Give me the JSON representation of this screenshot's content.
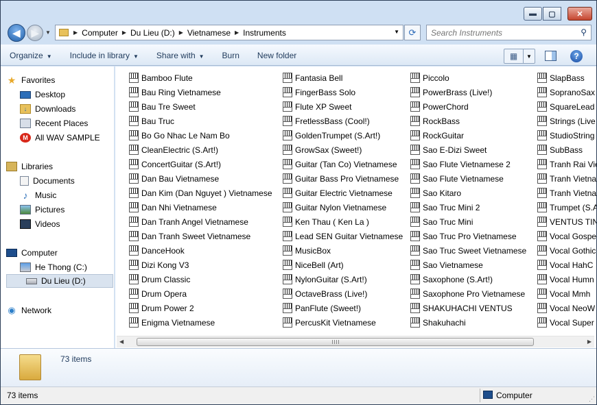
{
  "window": {
    "min_label": "▬",
    "max_label": "▢",
    "close_label": "✕"
  },
  "nav": {
    "back_icon": "arrow-left",
    "forward_icon": "arrow-right",
    "breadcrumbs": [
      "Computer",
      "Du Lieu (D:)",
      "Vietnamese",
      "Instruments"
    ],
    "search_placeholder": "Search Instruments"
  },
  "toolbar": {
    "organize": "Organize",
    "include": "Include in library",
    "share": "Share with",
    "burn": "Burn",
    "new_folder": "New folder"
  },
  "sidebar": {
    "favorites": {
      "label": "Favorites",
      "items": [
        "Desktop",
        "Downloads",
        "Recent Places",
        "All WAV SAMPLE"
      ]
    },
    "libraries": {
      "label": "Libraries",
      "items": [
        "Documents",
        "Music",
        "Pictures",
        "Videos"
      ]
    },
    "computer": {
      "label": "Computer",
      "items": [
        "He Thong (C:)",
        "Du Lieu (D:)"
      ]
    },
    "network": {
      "label": "Network"
    }
  },
  "files": {
    "col1": [
      "Bamboo Flute",
      "Bau Ring Vietnamese",
      "Bau Tre Sweet",
      "Bau Truc",
      "Bo Go Nhac Le Nam Bo",
      "CleanElectric (S.Art!)",
      "ConcertGuitar (S.Art!)",
      "Dan Bau Vietnamese",
      "Dan Kim (Dan Nguyet ) Vietnamese",
      "Dan Nhi Vietnamese",
      "Dan Tranh Angel Vietnamese",
      "Dan Tranh Sweet Vietnamese",
      "DanceHook",
      "Dizi Kong V3",
      "Drum Classic",
      "Drum Opera",
      "Drum Power 2",
      "Enigma Vietnamese"
    ],
    "col2": [
      "Fantasia Bell",
      "FingerBass Solo",
      "Flute XP Sweet",
      "FretlessBass (Cool!)",
      "GoldenTrumpet (S.Art!)",
      "GrowSax (Sweet!)",
      "Guitar (Tan Co) Vietnamese",
      "Guitar Bass Pro Vietnamese",
      "Guitar Electric Vietnamese",
      "Guitar Nylon Vietnamese",
      "Ken Thau ( Ken La )",
      "Lead SEN Guitar Vietnamese",
      "MusicBox",
      "NiceBell (Art)",
      "NylonGuitar (S.Art!)",
      "OctaveBrass (Live!)",
      "PanFlute (Sweet!)",
      "PercusKit Vietnamese"
    ],
    "col3": [
      "Piccolo",
      "PowerBrass (Live!)",
      "PowerChord",
      "RockBass",
      "RockGuitar",
      "Sao E-Dizi Sweet",
      "Sao Flute Vietnamese 2",
      "Sao Flute Vietnamese",
      "Sao Kitaro",
      "Sao Truc Mini 2",
      "Sao Truc Mini",
      "Sao Truc Pro Vietnamese",
      "Sao Truc Sweet Vietnamese",
      "Sao Vietnamese",
      "Saxophone (S.Art!)",
      "Saxophone Pro Vietnamese",
      "SHAKUHACHI VENTUS",
      "Shakuhachi"
    ],
    "col4": [
      "SlapBass",
      "SopranoSax",
      "SquareLead",
      "Strings (Live",
      "StudioString",
      "SubBass",
      "Tranh Rai Vie",
      "Tranh Vietna",
      "Tranh Vietna",
      "Trumpet (S.A",
      "VENTUS TIN",
      "Vocal Gospe",
      "Vocal Gothic",
      "Vocal HahC",
      "Vocal Humn",
      "Vocal Mmh",
      "Vocal NeoW",
      "Vocal Super"
    ]
  },
  "details": {
    "count": "73 items"
  },
  "status": {
    "count": "73 items",
    "location": "Computer"
  }
}
